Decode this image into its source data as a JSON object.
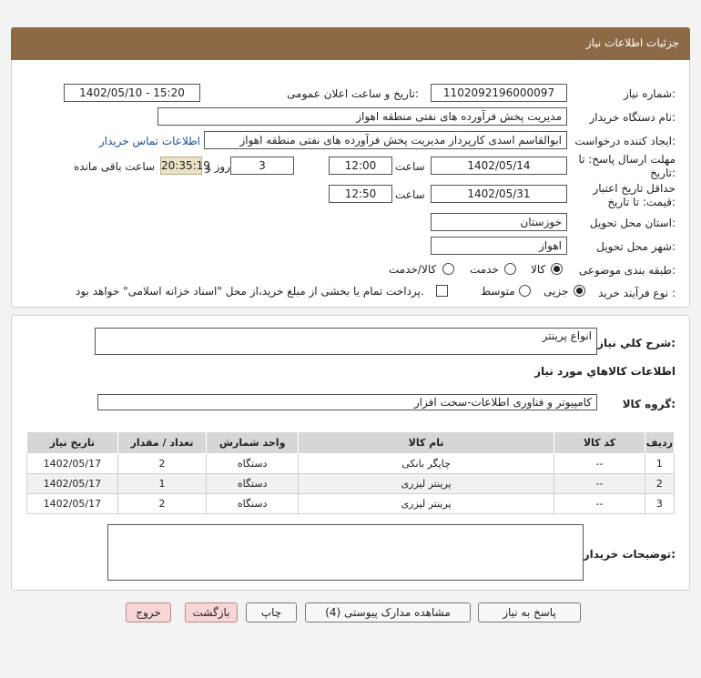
{
  "header": {
    "title": "جزئیات اطلاعات نیاز"
  },
  "fields": {
    "need_number_label": "شماره نیاز:",
    "need_number": "1102092196000097",
    "announce_label": "تاریخ و ساعت اعلان عمومی:",
    "announce_value": "1402/05/10 - 15:20",
    "buyer_org_label": "نام دستگاه خریدار:",
    "buyer_org": "مدیریت پخش فرآورده های نفتی منطقه اهواز",
    "requester_label": "ایجاد کننده درخواست:",
    "requester": "ابوالقاسم اسدی کارپرداز مدیریت پخش فرآورده های نفتی منطقه اهواز",
    "contact_link": "اطلاعات تماس خریدار",
    "deadline_label_1": "مهلت ارسال پاسخ: تا",
    "deadline_label_2": "تاریخ:",
    "deadline_date": "1402/05/14",
    "time_label": "ساعت",
    "deadline_time": "12:00",
    "days_value": "3",
    "days_label": "روز و",
    "remaining_time": "20:35:19",
    "remaining_label": "ساعت باقی مانده",
    "validity_label_1": "حداقل تاریخ اعتبار",
    "validity_label_2": "قیمت: تا تاریخ:",
    "validity_date": "1402/05/31",
    "validity_time": "12:50",
    "province_label": "استان محل تحویل:",
    "province": "خوزستان",
    "city_label": "شهر محل تحویل:",
    "city": "اهواز",
    "category_label": "طبقه بندی موضوعی:",
    "category_options": [
      "کالا",
      "خدمت",
      "کالا/خدمت"
    ],
    "process_label": "نوع فرآیند خرید :",
    "process_options": [
      "جزیی",
      "متوسط"
    ],
    "payment_note": "پرداخت تمام یا بخشی از مبلغ خرید،از محل \"اسناد خزانه اسلامی\" خواهد بود."
  },
  "summary": {
    "label": "شرح کلي نياز:",
    "value": "انواع پرینتر",
    "goods_info_title": "اطلاعات کالاهاي مورد نياز",
    "group_label": "گروه کالا:",
    "group_value": "کامپیوتر و فناوری اطلاعات-سخت افزار"
  },
  "table": {
    "headers": [
      "ردیف",
      "کد کالا",
      "نام کالا",
      "واحد شمارش",
      "تعداد / مقدار",
      "تاریخ نیاز"
    ],
    "rows": [
      [
        "1",
        "--",
        "چاپگر بانکی",
        "دستگاه",
        "2",
        "1402/05/17"
      ],
      [
        "2",
        "--",
        "پرینتر لیزری",
        "دستگاه",
        "1",
        "1402/05/17"
      ],
      [
        "3",
        "--",
        "پرینتر لیزری",
        "دستگاه",
        "2",
        "1402/05/17"
      ]
    ]
  },
  "buyer_notes_label": "توضیحات خریدار:",
  "buttons": {
    "reply": "پاسخ به نیاز",
    "attachments": "مشاهده مدارک پیوستی (4)",
    "print": "چاپ",
    "back": "بازگشت",
    "exit": "خروج"
  },
  "colors": {
    "header": "#8b6a45",
    "link": "#1a4fa0",
    "pink_button": "#f8d6d6"
  }
}
